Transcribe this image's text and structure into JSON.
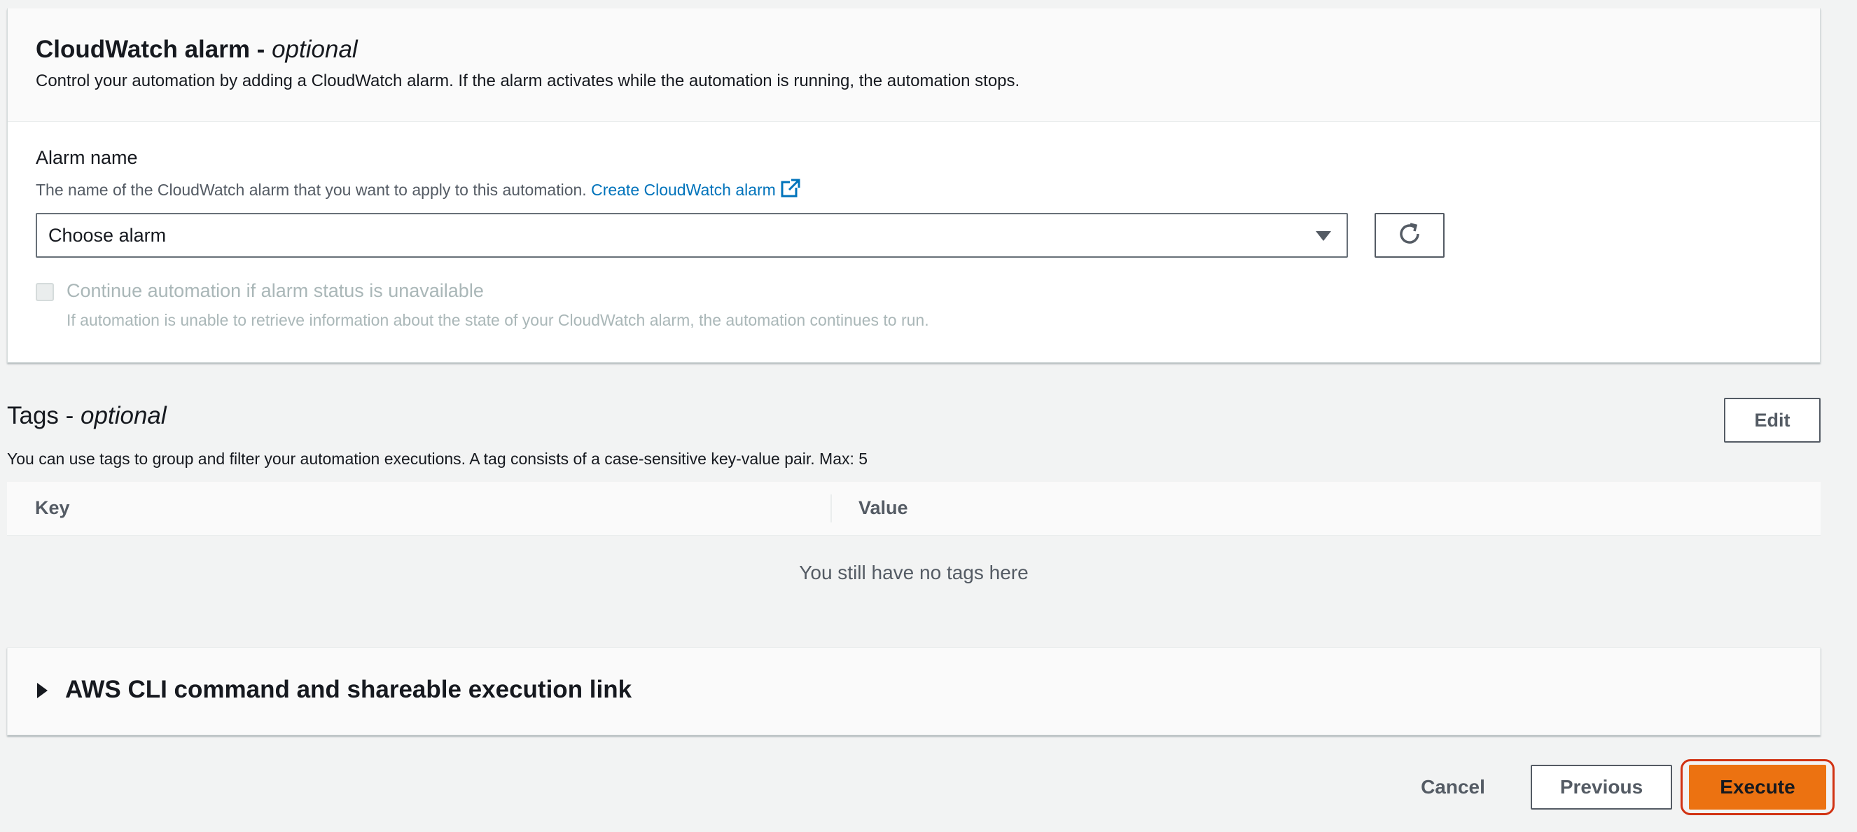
{
  "cloudwatch": {
    "title": "CloudWatch alarm - ",
    "title_optional": "optional",
    "description": "Control your automation by adding a CloudWatch alarm. If the alarm activates while the automation is running, the automation stops.",
    "alarm_label": "Alarm name",
    "alarm_desc": "The name of the CloudWatch alarm that you want to apply to this automation.",
    "create_link": "Create CloudWatch alarm",
    "select_value": "Choose alarm",
    "checkbox_label": "Continue automation if alarm status is unavailable",
    "checkbox_checked": false,
    "checkbox_desc": "If automation is unable to retrieve information about the state of your CloudWatch alarm, the automation continues to run."
  },
  "tags": {
    "title": "Tags - ",
    "title_optional": "optional",
    "description": "You can use tags to group and filter your automation executions. A tag consists of a case-sensitive key-value pair. Max: 5",
    "edit_label": "Edit",
    "columns": [
      "Key",
      "Value"
    ],
    "empty_message": "You still have no tags here"
  },
  "cli": {
    "title": "AWS CLI command and shareable execution link"
  },
  "footer": {
    "cancel_label": "Cancel",
    "previous_label": "Previous",
    "execute_label": "Execute"
  },
  "colors": {
    "primary": "#ec7211",
    "link": "#0073bb",
    "highlight": "#d13212"
  }
}
